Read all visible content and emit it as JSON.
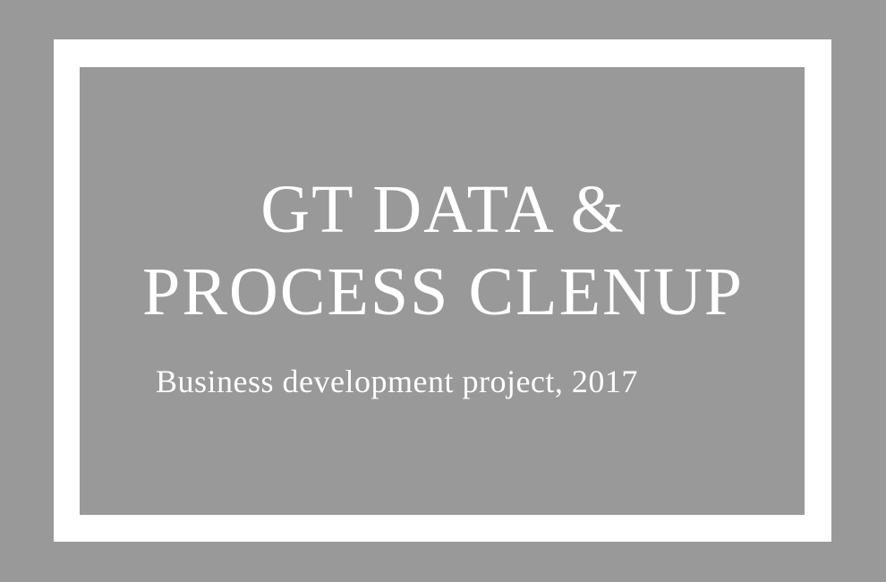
{
  "card": {
    "title_line_1": "GT DATA &",
    "title_line_2": "PROCESS CLENUP",
    "subtitle": "Business development project, 2017"
  },
  "colors": {
    "background": "#999999",
    "frame": "#ffffff",
    "text": "#ffffff"
  }
}
